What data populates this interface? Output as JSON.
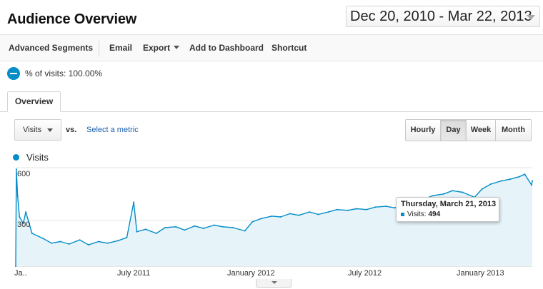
{
  "page": {
    "title": "Audience Overview",
    "date_range": "Dec 20, 2010 - Mar 22, 2013"
  },
  "toolbar": {
    "advanced_segments": "Advanced Segments",
    "email": "Email",
    "export": "Export",
    "add_to_dashboard": "Add to Dashboard",
    "shortcut": "Shortcut"
  },
  "segment": {
    "label": "% of visits: 100.00%"
  },
  "tabs": {
    "overview": "Overview"
  },
  "controls": {
    "metric": "Visits",
    "vs": "vs.",
    "select_metric": "Select a metric",
    "granularity": [
      {
        "label": "Hourly",
        "active": false
      },
      {
        "label": "Day",
        "active": true
      },
      {
        "label": "Week",
        "active": false
      },
      {
        "label": "Month",
        "active": false
      }
    ]
  },
  "legend": {
    "series_label": "Visits"
  },
  "tooltip": {
    "date": "Thursday, March 21, 2013",
    "metric": "Visits:",
    "value": "494"
  },
  "colors": {
    "series": "#058dc7",
    "area_fill": "#e6f4fa"
  },
  "chart_data": {
    "type": "area",
    "xlabel": "",
    "ylabel": "",
    "ylim": [
      0,
      600
    ],
    "y_ticks": [
      "600",
      "300"
    ],
    "x_ticks": [
      "Ja..",
      "July 2011",
      "January 2012",
      "July 2012",
      "January 2013"
    ],
    "series": [
      {
        "name": "Visits",
        "points": [
          [
            "2010-12-20",
            0
          ],
          [
            "2010-12-21",
            590
          ],
          [
            "2010-12-23",
            430
          ],
          [
            "2010-12-26",
            300
          ],
          [
            "2011-01-01",
            260
          ],
          [
            "2011-01-05",
            330
          ],
          [
            "2011-01-15",
            200
          ],
          [
            "2011-02-01",
            170
          ],
          [
            "2011-02-15",
            140
          ],
          [
            "2011-03-01",
            150
          ],
          [
            "2011-03-15",
            135
          ],
          [
            "2011-04-01",
            160
          ],
          [
            "2011-04-15",
            130
          ],
          [
            "2011-05-01",
            150
          ],
          [
            "2011-05-15",
            140
          ],
          [
            "2011-06-01",
            155
          ],
          [
            "2011-06-15",
            175
          ],
          [
            "2011-06-26",
            390
          ],
          [
            "2011-07-01",
            210
          ],
          [
            "2011-07-15",
            225
          ],
          [
            "2011-08-01",
            200
          ],
          [
            "2011-08-15",
            235
          ],
          [
            "2011-09-01",
            240
          ],
          [
            "2011-09-15",
            220
          ],
          [
            "2011-10-01",
            245
          ],
          [
            "2011-10-15",
            230
          ],
          [
            "2011-11-01",
            250
          ],
          [
            "2011-11-15",
            240
          ],
          [
            "2011-12-01",
            235
          ],
          [
            "2011-12-20",
            215
          ],
          [
            "2012-01-01",
            270
          ],
          [
            "2012-01-15",
            290
          ],
          [
            "2012-02-01",
            305
          ],
          [
            "2012-02-15",
            300
          ],
          [
            "2012-03-01",
            320
          ],
          [
            "2012-03-15",
            310
          ],
          [
            "2012-04-01",
            330
          ],
          [
            "2012-04-15",
            315
          ],
          [
            "2012-05-01",
            330
          ],
          [
            "2012-05-15",
            345
          ],
          [
            "2012-06-01",
            340
          ],
          [
            "2012-06-15",
            350
          ],
          [
            "2012-07-01",
            345
          ],
          [
            "2012-07-15",
            360
          ],
          [
            "2012-08-01",
            365
          ],
          [
            "2012-08-15",
            355
          ],
          [
            "2012-09-01",
            385
          ],
          [
            "2012-09-15",
            395
          ],
          [
            "2012-10-01",
            410
          ],
          [
            "2012-10-15",
            430
          ],
          [
            "2012-11-01",
            440
          ],
          [
            "2012-11-15",
            460
          ],
          [
            "2012-12-01",
            450
          ],
          [
            "2012-12-20",
            420
          ],
          [
            "2013-01-01",
            470
          ],
          [
            "2013-01-15",
            500
          ],
          [
            "2013-02-01",
            520
          ],
          [
            "2013-02-15",
            530
          ],
          [
            "2013-03-01",
            545
          ],
          [
            "2013-03-10",
            560
          ],
          [
            "2013-03-21",
            494
          ],
          [
            "2013-03-22",
            520
          ]
        ]
      }
    ]
  }
}
